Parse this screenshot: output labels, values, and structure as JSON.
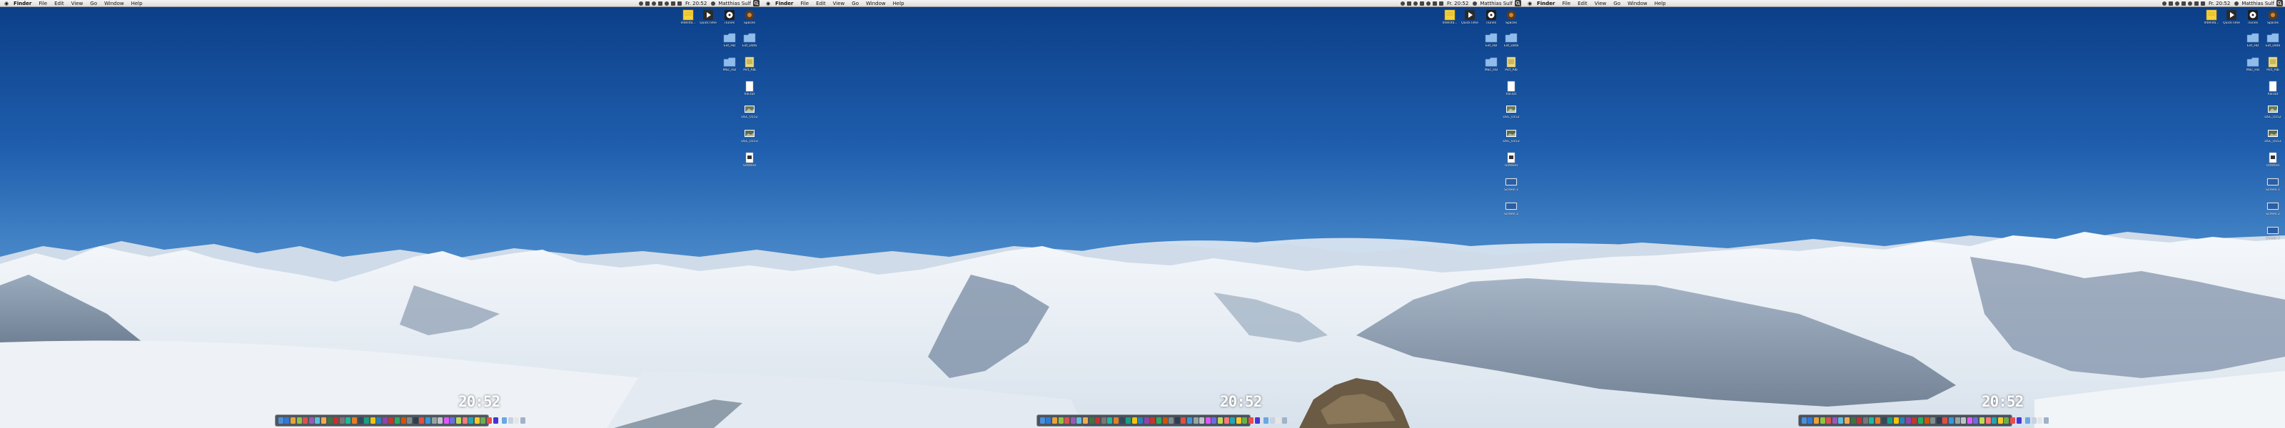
{
  "menu": {
    "apple": "",
    "app_name": "Finder",
    "items": [
      "File",
      "Edit",
      "View",
      "Go",
      "Window",
      "Help"
    ],
    "clock": "Fr. 20:52",
    "user": "Matthias Sulf"
  },
  "desktop_icons": [
    {
      "label": "Intellifa...",
      "icon": "sticky-note-icon"
    },
    {
      "label": "QuickTime",
      "icon": "quicktime-icon"
    },
    {
      "label": "iTunes",
      "icon": "itunes-icon"
    },
    {
      "label": "Spaces",
      "icon": "spaces-icon"
    },
    {
      "label": "Ext_HD",
      "icon": "folder-icon"
    },
    {
      "label": "Ext_Data",
      "icon": "folder-icon"
    },
    {
      "label": "Mac_HD",
      "icon": "folder-icon"
    },
    {
      "label": "Pict_Alb",
      "icon": "note-file-icon"
    },
    {
      "label": "file.txt",
      "icon": "document-icon"
    },
    {
      "label": "DSC_0152",
      "icon": "photo-icon"
    },
    {
      "label": "DSC_0153",
      "icon": "photo-icon"
    },
    {
      "label": "Untitled",
      "icon": "document-icon"
    },
    {
      "label": "Screen 1",
      "icon": "screenshot-icon"
    },
    {
      "label": "Screen 2",
      "icon": "screenshot-icon"
    }
  ],
  "big_clock": "20:52",
  "dock_colors": [
    "#4a90d9",
    "#2f7ad6",
    "#e8a33a",
    "#8cc63f",
    "#d9534f",
    "#9b59b6",
    "#5bc0de",
    "#f0ad4e",
    "#3c763d",
    "#c9302c",
    "#777777",
    "#1abc9c",
    "#e67e22",
    "#34495e",
    "#16a085",
    "#f1c40f",
    "#2980b9",
    "#8e44ad",
    "#c0392b",
    "#27ae60",
    "#d35400",
    "#7f8c8d",
    "#2c3e50",
    "#e74c3c",
    "#3498db",
    "#95a5a6",
    "#bdc3c7",
    "#e056fd",
    "#686de0",
    "#badc58",
    "#ff7979",
    "#22a6b3",
    "#f9ca24",
    "#6ab04c",
    "#eb4d4b",
    "#4834d4"
  ],
  "dock_right_colors": [
    "#6aa7e3",
    "#c7d3e0",
    "#e6e6e6",
    "#9fb3c8"
  ]
}
